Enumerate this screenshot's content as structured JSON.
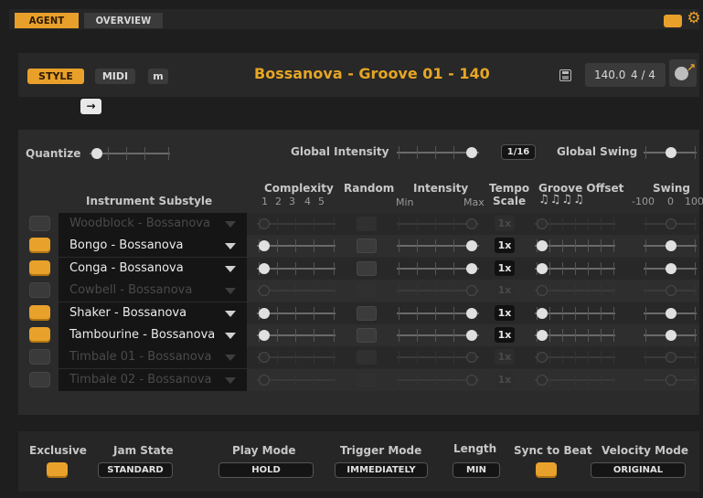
{
  "top_tabs": {
    "agent": "AGENT",
    "overview": "OVERVIEW"
  },
  "header": {
    "style_btn": "STYLE",
    "midi_btn": "MIDI",
    "m_btn": "m",
    "title": "Bossanova - Groove 01 - 140",
    "tempo": "140.0",
    "signature": "4 / 4"
  },
  "controls": {
    "quantize_label": "Quantize",
    "global_intensity_label": "Global Intensity",
    "quantize_value": "1/16",
    "global_swing_label": "Global Swing"
  },
  "columns": {
    "instrument": "Instrument Substyle",
    "complexity": "Complexity",
    "complexity_ticks": [
      "1",
      "2",
      "3",
      "4",
      "5"
    ],
    "random": "Random",
    "intensity": "Intensity",
    "intensity_min": "Min",
    "intensity_max": "Max",
    "tempo_scale_1": "Tempo",
    "tempo_scale_2": "Scale",
    "groove_offset": "Groove Offset",
    "groove_notes": "♫♫♫♫",
    "swing": "Swing",
    "swing_ticks": [
      "-100",
      "0",
      "100"
    ]
  },
  "rows": [
    {
      "name": "Woodblock - Bossanova",
      "active": false,
      "tempo": "1x"
    },
    {
      "name": "Bongo - Bossanova",
      "active": true,
      "tempo": "1x"
    },
    {
      "name": "Conga - Bossanova",
      "active": true,
      "tempo": "1x"
    },
    {
      "name": "Cowbell - Bossanova",
      "active": false,
      "tempo": "1x"
    },
    {
      "name": "Shaker - Bossanova",
      "active": true,
      "tempo": "1x"
    },
    {
      "name": "Tambourine - Bossanova",
      "active": true,
      "tempo": "1x"
    },
    {
      "name": "Timbale 01 - Bossanova",
      "active": false,
      "tempo": "1x"
    },
    {
      "name": "Timbale 02 - Bossanova",
      "active": false,
      "tempo": "1x"
    }
  ],
  "bottom": {
    "exclusive": "Exclusive",
    "jam_state": "Jam State",
    "jam_state_value": "STANDARD",
    "play_mode": "Play Mode",
    "play_mode_value": "HOLD",
    "trigger_mode": "Trigger Mode",
    "trigger_mode_value": "IMMEDIATELY",
    "length": "Length",
    "length_value": "MIN",
    "sync_to_beat": "Sync to Beat",
    "velocity_mode": "Velocity Mode",
    "velocity_mode_value": "ORIGINAL"
  },
  "colors": {
    "accent": "#e9a02a",
    "title": "#e6a624"
  }
}
